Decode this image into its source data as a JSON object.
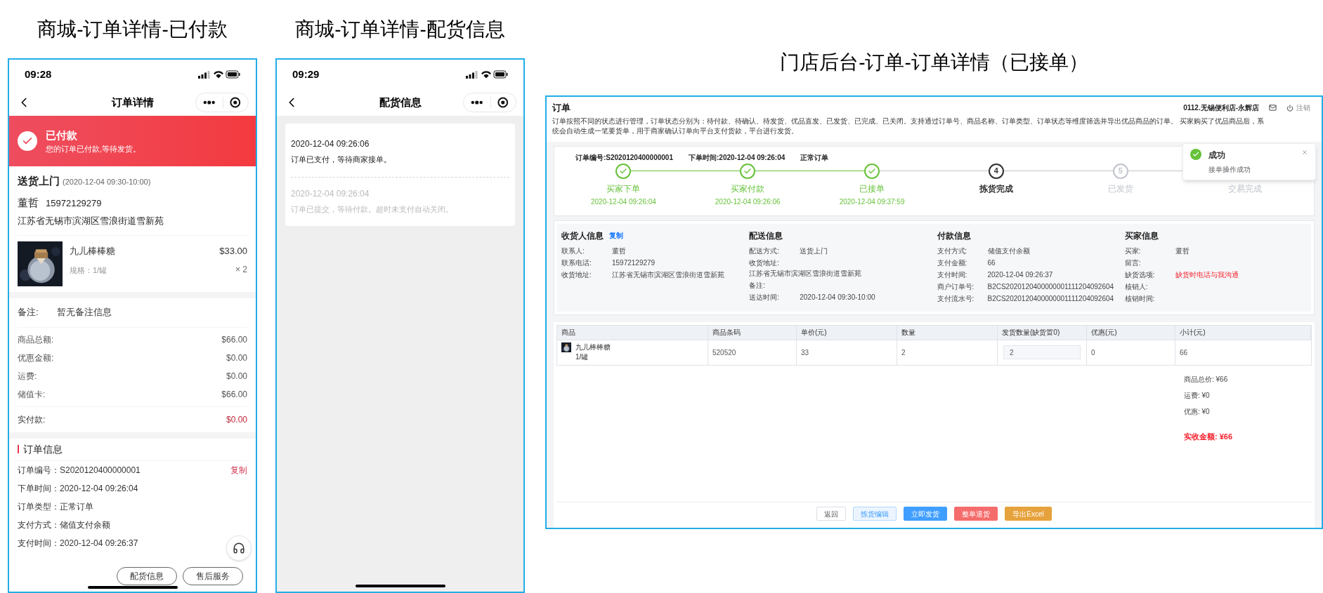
{
  "mall_order": {
    "title": "商城-订单详情-已付款",
    "status_bar": {
      "time": "09:28"
    },
    "nav": {
      "title": "订单详情"
    },
    "banner": {
      "title": "已付款",
      "subtitle": "您的订单已付款,等待发货。"
    },
    "delivery": {
      "method": "送货上门",
      "window": "(2020-12-04 09:30-10:00)",
      "name": "董哲",
      "phone": "15972129279",
      "address": "江苏省无锡市滨湖区雪浪街道雪新苑"
    },
    "product": {
      "name": "九儿棒棒糖",
      "spec": "规格：1/罐",
      "price": "$33.00",
      "qty": "× 2"
    },
    "remark": {
      "label": "备注:",
      "value": "暂无备注信息"
    },
    "amounts": [
      {
        "label": "商品总额:",
        "value": "$66.00"
      },
      {
        "label": "优惠金额:",
        "value": "$0.00"
      },
      {
        "label": "运费:",
        "value": "$0.00"
      },
      {
        "label": "储值卡:",
        "value": "$66.00"
      }
    ],
    "total": {
      "label": "实付款:",
      "value": "$0.00"
    },
    "order_info": {
      "heading": "订单信息",
      "copy": "复制",
      "rows": [
        {
          "label": "订单编号：",
          "value": "S2020120400000001"
        },
        {
          "label": "下单时间：",
          "value": "2020-12-04 09:26:04"
        },
        {
          "label": "订单类型：",
          "value": "正常订单"
        },
        {
          "label": "支付方式：",
          "value": "储值支付余额"
        },
        {
          "label": "支付时间：",
          "value": "2020-12-04 09:26:37"
        }
      ]
    },
    "buttons": [
      "配货信息",
      "售后服务"
    ]
  },
  "mall_delivery": {
    "title": "商城-订单详情-配货信息",
    "status_bar": {
      "time": "09:29"
    },
    "nav": {
      "title": "配货信息"
    },
    "log": [
      {
        "time": "2020-12-04 09:26:06",
        "text": "订单已支付，等待商家接单。",
        "current": true
      },
      {
        "time": "2020-12-04 09:26:04",
        "text": "订单已提交，等待付款。超时未支付自动关闭。",
        "current": false
      }
    ]
  },
  "store_admin": {
    "title": "门店后台-订单-订单详情（已接单）",
    "header": {
      "heading": "订单",
      "description": "订单按照不同的状态进行管理，订单状态分别为：待付款、待确认、待发货、优品直发、已发货、已完成、已关闭。支持通过订单号、商品名称、订单类型、订单状态等维度筛选并导出优品商品的订单。 买家购买了优品商品后，系统会自动生成一笔要货单，用于商家确认订单向平台支付货款，平台进行发货。",
      "store": "0112.无锡便利店-永辉店",
      "logout": "注销"
    },
    "order_meta": [
      "订单编号:S2020120400000001",
      "下单时间:2020-12-04 09:26:04",
      "正常订单"
    ],
    "steps": [
      {
        "label": "买家下单",
        "time": "2020-12-04 09:26:04",
        "done": true,
        "current": false
      },
      {
        "label": "买家付款",
        "time": "2020-12-04 09:26:06",
        "done": true,
        "current": false
      },
      {
        "label": "已接单",
        "time": "2020-12-04 09:37:59",
        "done": true,
        "current": false
      },
      {
        "label": "拣货完成",
        "number": "4",
        "done": false,
        "current": true
      },
      {
        "label": "已发货",
        "number": "5",
        "done": false,
        "current": false
      },
      {
        "label": "交易完成",
        "done": false,
        "current": false
      }
    ],
    "toast": {
      "title": "成功",
      "message": "接单操作成功"
    },
    "info_sections": [
      {
        "heading": "收货人信息",
        "action": "复制",
        "rows": [
          {
            "label": "联系人:",
            "value": "董哲",
            "kind": "inline"
          },
          {
            "label": "联系电话:",
            "value": "15972129279",
            "kind": "inline"
          },
          {
            "label": "收货地址:",
            "value": "江苏省无锡市滨湖区雪浪街道雪新苑",
            "kind": "inline"
          }
        ]
      },
      {
        "heading": "配送信息",
        "rows": [
          {
            "label": "配送方式:",
            "value": "送货上门",
            "kind": "inline"
          },
          {
            "label": "收货地址:",
            "value": "江苏省无锡市滨湖区雪浪街道雪新苑",
            "kind": "stacked"
          },
          {
            "label": "备注:",
            "kind": "inline"
          },
          {
            "label": "送达时间:",
            "value": "2020-12-04 09:30-10:00",
            "kind": "inline"
          }
        ]
      },
      {
        "heading": "付款信息",
        "rows": [
          {
            "label": "支付方式:",
            "value": "储值支付余额",
            "kind": "inline"
          },
          {
            "label": "支付金额:",
            "value": "66",
            "kind": "inline"
          },
          {
            "label": "支付时间:",
            "value": "2020-12-04 09:26:37",
            "kind": "inline"
          },
          {
            "label": "商户订单号:",
            "value": "B2CS2020120400000001111204092604",
            "kind": "inline"
          },
          {
            "label": "支付流水号:",
            "value": "B2CS2020120400000001111204092604",
            "kind": "inline"
          }
        ]
      },
      {
        "heading": "买家信息",
        "rows": [
          {
            "label": "买家:",
            "value": "董哲",
            "kind": "inline"
          },
          {
            "label": "留言:",
            "kind": "inline"
          },
          {
            "label": "缺货选项:",
            "value": "缺货时电话与我沟通",
            "kind": "alert"
          },
          {
            "label": "核销人:",
            "kind": "inline"
          },
          {
            "label": "核销时间:",
            "kind": "inline"
          }
        ]
      }
    ],
    "table": {
      "columns": [
        "商品",
        "商品条码",
        "单价(元)",
        "数量",
        "发货数量(缺货置0)",
        "优惠(元)",
        "小计(元)"
      ],
      "rows": [
        {
          "name": "九儿棒棒糖",
          "spec": "1/罐",
          "barcode": "520520",
          "price": "33",
          "qty": "2",
          "ship_qty": "2",
          "discount": "0",
          "subtotal": "66"
        }
      ]
    },
    "summary": [
      "商品总价: ¥66",
      "运费: ¥0",
      "优惠: ¥0"
    ],
    "total": "实收金额: ¥66",
    "buttons": [
      {
        "label": "返回",
        "kind": "default"
      },
      {
        "label": "拣货编辑",
        "kind": "light"
      },
      {
        "label": "立即发货",
        "kind": "primary"
      },
      {
        "label": "整单退货",
        "kind": "danger"
      },
      {
        "label": "导出Excel",
        "kind": "warning"
      }
    ]
  }
}
